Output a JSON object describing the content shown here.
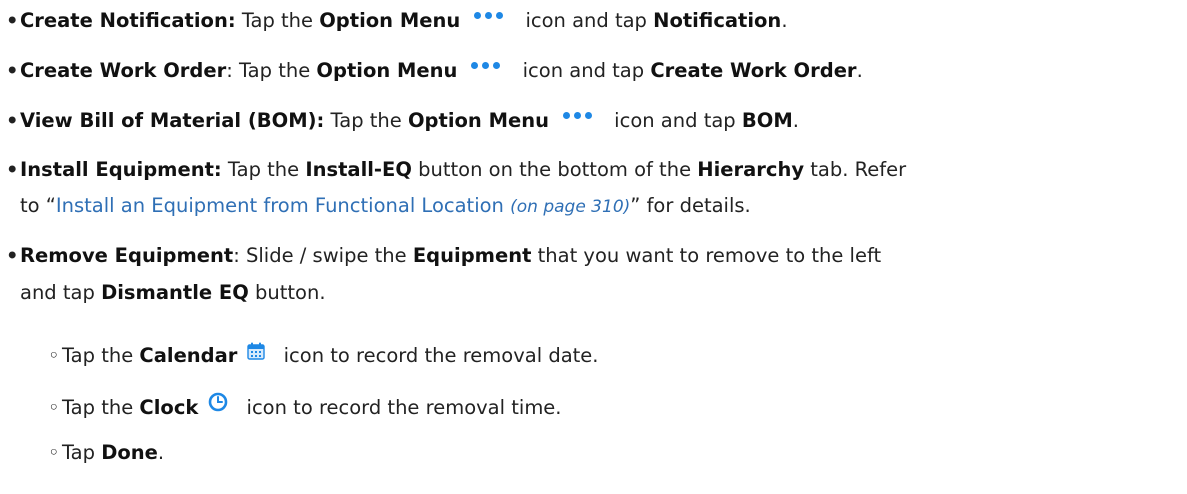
{
  "bullet": "•",
  "sub_bullet": "◦",
  "icons": {
    "option_menu": "three-dots-icon",
    "calendar": "calendar-icon",
    "clock": "clock-icon",
    "accent_color": "#1e88e5",
    "link_color": "#2f6fb5"
  },
  "items": {
    "notification": {
      "title": "Create Notification:",
      "p1": " Tap the ",
      "b1": "Option Menu",
      "p2": " icon and tap ",
      "b2": "Notification",
      "p3": "."
    },
    "work_order": {
      "title": "Create Work Order",
      "p1": ": Tap the ",
      "b1": "Option Menu",
      "p2": " icon and tap ",
      "b2": "Create Work Order",
      "p3": "."
    },
    "bom": {
      "title": "View Bill of Material (BOM):",
      "p1": " Tap the ",
      "b1": "Option Menu",
      "p2": " icon and tap ",
      "b2": "BOM",
      "p3": "."
    },
    "install": {
      "title": "Install Equipment:",
      "p1": " Tap the ",
      "b1": "Install-EQ",
      "p2": " button on the bottom of the ",
      "b2": "Hierarchy",
      "p3": " tab. Refer",
      "l2_p1": "to “",
      "link_text": "Install an Equipment from Functional Location ",
      "link_page": "(on page 310)",
      "l2_p2": "” for details."
    },
    "remove": {
      "title": "Remove Equipment",
      "p1": ": Slide / swipe the ",
      "b1": "Equipment",
      "p2": " that you want to remove to the left",
      "l2_p1": "and tap ",
      "l2_b1": "Dismantle EQ",
      "l2_p2": " button."
    }
  },
  "sub_items": {
    "calendar": {
      "p1": "Tap the ",
      "b1": "Calendar",
      "p2": " icon to record the removal date."
    },
    "clock": {
      "p1": "Tap the ",
      "b1": "Clock",
      "p2": " icon to record the removal time."
    },
    "done": {
      "p1": "Tap ",
      "b1": "Done",
      "p2": "."
    }
  }
}
